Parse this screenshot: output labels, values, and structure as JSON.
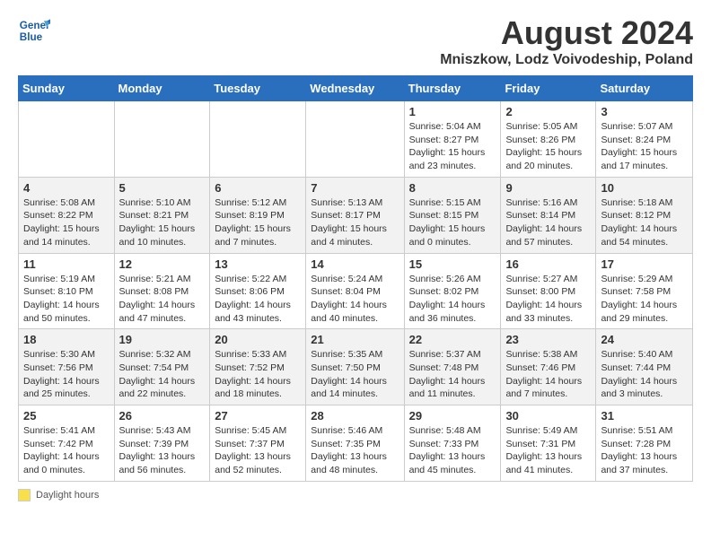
{
  "header": {
    "logo_line1": "General",
    "logo_line2": "Blue",
    "month": "August 2024",
    "location": "Mniszkow, Lodz Voivodeship, Poland"
  },
  "days_of_week": [
    "Sunday",
    "Monday",
    "Tuesday",
    "Wednesday",
    "Thursday",
    "Friday",
    "Saturday"
  ],
  "weeks": [
    [
      {
        "day": "",
        "info": ""
      },
      {
        "day": "",
        "info": ""
      },
      {
        "day": "",
        "info": ""
      },
      {
        "day": "",
        "info": ""
      },
      {
        "day": "1",
        "info": "Sunrise: 5:04 AM\nSunset: 8:27 PM\nDaylight: 15 hours\nand 23 minutes."
      },
      {
        "day": "2",
        "info": "Sunrise: 5:05 AM\nSunset: 8:26 PM\nDaylight: 15 hours\nand 20 minutes."
      },
      {
        "day": "3",
        "info": "Sunrise: 5:07 AM\nSunset: 8:24 PM\nDaylight: 15 hours\nand 17 minutes."
      }
    ],
    [
      {
        "day": "4",
        "info": "Sunrise: 5:08 AM\nSunset: 8:22 PM\nDaylight: 15 hours\nand 14 minutes."
      },
      {
        "day": "5",
        "info": "Sunrise: 5:10 AM\nSunset: 8:21 PM\nDaylight: 15 hours\nand 10 minutes."
      },
      {
        "day": "6",
        "info": "Sunrise: 5:12 AM\nSunset: 8:19 PM\nDaylight: 15 hours\nand 7 minutes."
      },
      {
        "day": "7",
        "info": "Sunrise: 5:13 AM\nSunset: 8:17 PM\nDaylight: 15 hours\nand 4 minutes."
      },
      {
        "day": "8",
        "info": "Sunrise: 5:15 AM\nSunset: 8:15 PM\nDaylight: 15 hours\nand 0 minutes."
      },
      {
        "day": "9",
        "info": "Sunrise: 5:16 AM\nSunset: 8:14 PM\nDaylight: 14 hours\nand 57 minutes."
      },
      {
        "day": "10",
        "info": "Sunrise: 5:18 AM\nSunset: 8:12 PM\nDaylight: 14 hours\nand 54 minutes."
      }
    ],
    [
      {
        "day": "11",
        "info": "Sunrise: 5:19 AM\nSunset: 8:10 PM\nDaylight: 14 hours\nand 50 minutes."
      },
      {
        "day": "12",
        "info": "Sunrise: 5:21 AM\nSunset: 8:08 PM\nDaylight: 14 hours\nand 47 minutes."
      },
      {
        "day": "13",
        "info": "Sunrise: 5:22 AM\nSunset: 8:06 PM\nDaylight: 14 hours\nand 43 minutes."
      },
      {
        "day": "14",
        "info": "Sunrise: 5:24 AM\nSunset: 8:04 PM\nDaylight: 14 hours\nand 40 minutes."
      },
      {
        "day": "15",
        "info": "Sunrise: 5:26 AM\nSunset: 8:02 PM\nDaylight: 14 hours\nand 36 minutes."
      },
      {
        "day": "16",
        "info": "Sunrise: 5:27 AM\nSunset: 8:00 PM\nDaylight: 14 hours\nand 33 minutes."
      },
      {
        "day": "17",
        "info": "Sunrise: 5:29 AM\nSunset: 7:58 PM\nDaylight: 14 hours\nand 29 minutes."
      }
    ],
    [
      {
        "day": "18",
        "info": "Sunrise: 5:30 AM\nSunset: 7:56 PM\nDaylight: 14 hours\nand 25 minutes."
      },
      {
        "day": "19",
        "info": "Sunrise: 5:32 AM\nSunset: 7:54 PM\nDaylight: 14 hours\nand 22 minutes."
      },
      {
        "day": "20",
        "info": "Sunrise: 5:33 AM\nSunset: 7:52 PM\nDaylight: 14 hours\nand 18 minutes."
      },
      {
        "day": "21",
        "info": "Sunrise: 5:35 AM\nSunset: 7:50 PM\nDaylight: 14 hours\nand 14 minutes."
      },
      {
        "day": "22",
        "info": "Sunrise: 5:37 AM\nSunset: 7:48 PM\nDaylight: 14 hours\nand 11 minutes."
      },
      {
        "day": "23",
        "info": "Sunrise: 5:38 AM\nSunset: 7:46 PM\nDaylight: 14 hours\nand 7 minutes."
      },
      {
        "day": "24",
        "info": "Sunrise: 5:40 AM\nSunset: 7:44 PM\nDaylight: 14 hours\nand 3 minutes."
      }
    ],
    [
      {
        "day": "25",
        "info": "Sunrise: 5:41 AM\nSunset: 7:42 PM\nDaylight: 14 hours\nand 0 minutes."
      },
      {
        "day": "26",
        "info": "Sunrise: 5:43 AM\nSunset: 7:39 PM\nDaylight: 13 hours\nand 56 minutes."
      },
      {
        "day": "27",
        "info": "Sunrise: 5:45 AM\nSunset: 7:37 PM\nDaylight: 13 hours\nand 52 minutes."
      },
      {
        "day": "28",
        "info": "Sunrise: 5:46 AM\nSunset: 7:35 PM\nDaylight: 13 hours\nand 48 minutes."
      },
      {
        "day": "29",
        "info": "Sunrise: 5:48 AM\nSunset: 7:33 PM\nDaylight: 13 hours\nand 45 minutes."
      },
      {
        "day": "30",
        "info": "Sunrise: 5:49 AM\nSunset: 7:31 PM\nDaylight: 13 hours\nand 41 minutes."
      },
      {
        "day": "31",
        "info": "Sunrise: 5:51 AM\nSunset: 7:28 PM\nDaylight: 13 hours\nand 37 minutes."
      }
    ]
  ],
  "footer": {
    "legend_label": "Daylight hours"
  }
}
